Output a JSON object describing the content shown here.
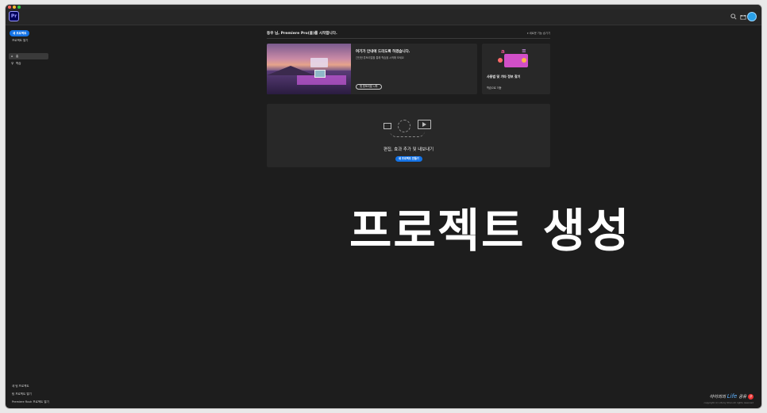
{
  "app": {
    "logo_text": "Pr",
    "accent_color": "#1473e6"
  },
  "topbar": {
    "icons": [
      "search-icon",
      "gift-icon",
      "avatar"
    ]
  },
  "sidebar": {
    "new_project_label": "새 프로젝트",
    "open_project_label": "프로젝트 열기",
    "nav": [
      {
        "label": "홈",
        "icon": "home-icon"
      },
      {
        "label": "학습",
        "icon": "learn-icon"
      }
    ],
    "bottom_links": [
      "새 팀 프로젝트",
      "팀 프로젝트 열기",
      "Premiere Rush 프로젝트 열기"
    ]
  },
  "main": {
    "welcome": "동우 님, Premiere Pro(을)를 시작합니다.",
    "whats_new": "새로운 기능 숨기기",
    "tour_card": {
      "title": "여기가 안내에 드리도록 하겠습니다.",
      "subtitle": "간단한 튜토리얼을 통해 학습을 시작해 보세요",
      "button": "첫 튜토리얼 시작"
    },
    "resources_card": {
      "title": "사용법 및 기타 정보 찾기",
      "link": "학습으로 이동"
    },
    "create_card": {
      "title": "편집, 효과 추가 및 내보내기",
      "button": "새 프로젝트 만들기"
    }
  },
  "overlay": {
    "text": "프로젝트 생성"
  },
  "watermark": {
    "line1_prefix": "아이의의 ",
    "line1_life": "Life",
    "line1_suffix": " 공유",
    "badge": "공",
    "line2": "copyright (c) Life by Shan All rights reserved"
  }
}
